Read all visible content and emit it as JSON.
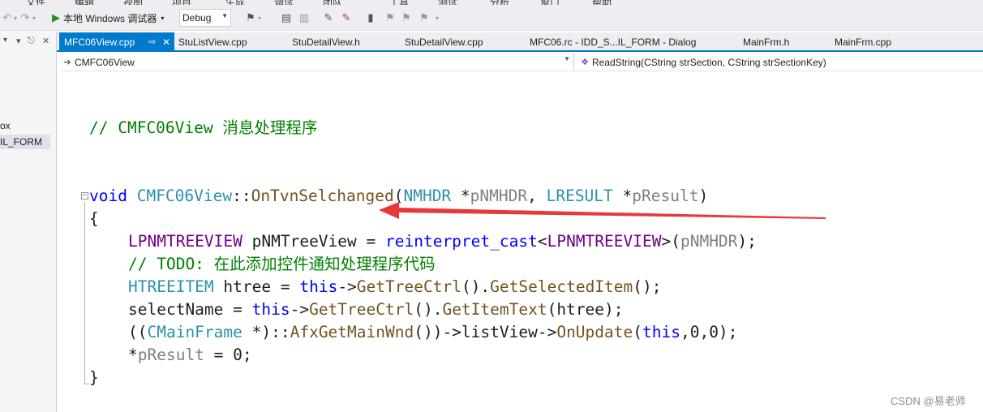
{
  "menu_partial": [
    "文件",
    "编辑",
    "视图",
    "项目",
    "生成",
    "调试",
    "团队",
    "工具",
    "测试",
    "分析",
    "窗口",
    "帮助"
  ],
  "toolbar": {
    "run_label": "本地 Windows 调试器",
    "config_value": "Debug",
    "icons": [
      "undo-icon",
      "redo-icon",
      "run-icon",
      "find-icon",
      "align-icon",
      "comment-icon",
      "uncomment-icon",
      "bookmark-icon"
    ]
  },
  "left_panel": {
    "items": [
      "ox",
      "IL_FORM"
    ],
    "selected_index": 1
  },
  "tabs": [
    {
      "label": "MFC06View.cpp",
      "active": true
    },
    {
      "label": "StuListView.cpp",
      "active": false
    },
    {
      "label": "StuDetailView.h",
      "active": false
    },
    {
      "label": "StuDetailView.cpp",
      "active": false
    },
    {
      "label": "MFC06.rc - IDD_S...IL_FORM - Dialog",
      "active": false
    },
    {
      "label": "MainFrm.h",
      "active": false
    },
    {
      "label": "MainFrm.cpp",
      "active": false
    }
  ],
  "navbar": {
    "class_scope": "CMFC06View",
    "member": "ReadString(CString strSection, CString strSectionKey)"
  },
  "code": {
    "comment_header": "// CMFC06View 消息处理程序",
    "todo_comment": "// TODO: 在此添加控件通知处理程序代码"
  },
  "annotation_arrow_color": "#e8393a",
  "watermark": "CSDN @易老师"
}
